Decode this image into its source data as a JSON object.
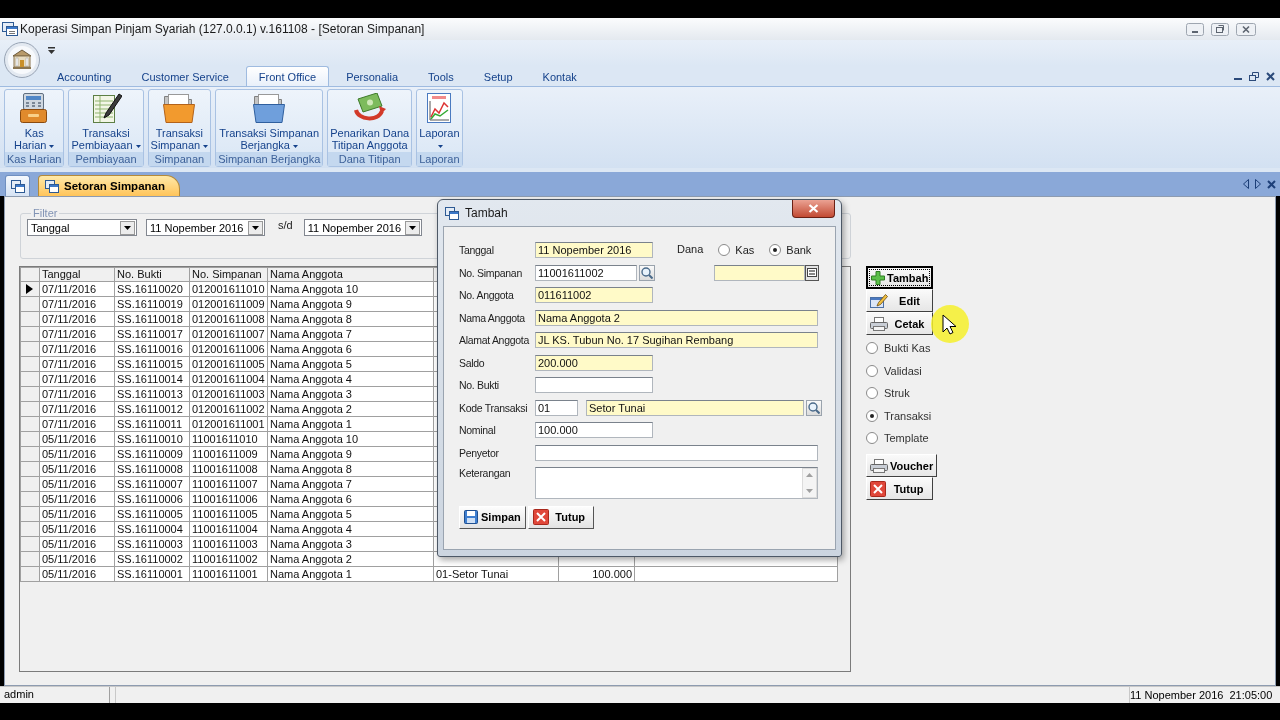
{
  "window": {
    "title": "Koperasi Simpan Pinjam Syariah (127.0.0.1) v.161108 - [Setoran Simpanan]"
  },
  "ribbon": {
    "tabs": [
      {
        "label": "Accounting",
        "selected": false
      },
      {
        "label": "Customer Service",
        "selected": false
      },
      {
        "label": "Front Office",
        "selected": true
      },
      {
        "label": "Personalia",
        "selected": false
      },
      {
        "label": "Tools",
        "selected": false
      },
      {
        "label": "Setup",
        "selected": false
      },
      {
        "label": "Kontak",
        "selected": false
      }
    ],
    "groups": [
      {
        "caption": "Kas Harian",
        "button": {
          "lines": [
            "Kas",
            "Harian"
          ],
          "dropdown": true
        }
      },
      {
        "caption": "Pembiayaan",
        "button": {
          "lines": [
            "Transaksi",
            "Pembiayaan"
          ],
          "dropdown": true
        }
      },
      {
        "caption": "Simpanan",
        "button": {
          "lines": [
            "Transaksi",
            "Simpanan"
          ],
          "dropdown": true
        }
      },
      {
        "caption": "Simpanan Berjangka",
        "button": {
          "lines": [
            "Transaksi Simpanan",
            "Berjangka"
          ],
          "dropdown": true
        }
      },
      {
        "caption": "Dana Titipan",
        "button": {
          "lines": [
            "Penarikan Dana",
            "Titipan Anggota"
          ],
          "dropdown": false
        }
      },
      {
        "caption": "Laporan",
        "button": {
          "lines": [
            "Laporan"
          ],
          "dropdown": true
        }
      }
    ]
  },
  "documents": {
    "tabs": [
      {
        "label": "Setoran Simpanan",
        "selected": true
      }
    ]
  },
  "filter": {
    "legend": "Filter",
    "field": "Tanggal",
    "from": "11 Nopember 2016",
    "separator": "s/d",
    "to": "11 Nopember 2016"
  },
  "table": {
    "columns": [
      "Tanggal",
      "No. Bukti",
      "No. Simpanan",
      "Nama Anggota"
    ],
    "rows": [
      {
        "selected": true,
        "cells": [
          "07/11/2016",
          "SS.16110020",
          "012001611010",
          "Nama Anggota 10"
        ]
      },
      {
        "selected": false,
        "cells": [
          "07/11/2016",
          "SS.16110019",
          "012001611009",
          "Nama Anggota 9"
        ]
      },
      {
        "selected": false,
        "cells": [
          "07/11/2016",
          "SS.16110018",
          "012001611008",
          "Nama Anggota 8"
        ]
      },
      {
        "selected": false,
        "cells": [
          "07/11/2016",
          "SS.16110017",
          "012001611007",
          "Nama Anggota 7"
        ]
      },
      {
        "selected": false,
        "cells": [
          "07/11/2016",
          "SS.16110016",
          "012001611006",
          "Nama Anggota 6"
        ]
      },
      {
        "selected": false,
        "cells": [
          "07/11/2016",
          "SS.16110015",
          "012001611005",
          "Nama Anggota 5"
        ]
      },
      {
        "selected": false,
        "cells": [
          "07/11/2016",
          "SS.16110014",
          "012001611004",
          "Nama Anggota 4"
        ]
      },
      {
        "selected": false,
        "cells": [
          "07/11/2016",
          "SS.16110013",
          "012001611003",
          "Nama Anggota 3"
        ]
      },
      {
        "selected": false,
        "cells": [
          "07/11/2016",
          "SS.16110012",
          "012001611002",
          "Nama Anggota 2"
        ]
      },
      {
        "selected": false,
        "cells": [
          "07/11/2016",
          "SS.16110011",
          "012001611001",
          "Nama Anggota 1"
        ]
      },
      {
        "selected": false,
        "cells": [
          "05/11/2016",
          "SS.16110010",
          "11001611010",
          "Nama Anggota 10"
        ]
      },
      {
        "selected": false,
        "cells": [
          "05/11/2016",
          "SS.16110009",
          "11001611009",
          "Nama Anggota 9"
        ]
      },
      {
        "selected": false,
        "cells": [
          "05/11/2016",
          "SS.16110008",
          "11001611008",
          "Nama Anggota 8"
        ]
      },
      {
        "selected": false,
        "cells": [
          "05/11/2016",
          "SS.16110007",
          "11001611007",
          "Nama Anggota 7"
        ]
      },
      {
        "selected": false,
        "cells": [
          "05/11/2016",
          "SS.16110006",
          "11001611006",
          "Nama Anggota 6"
        ]
      },
      {
        "selected": false,
        "cells": [
          "05/11/2016",
          "SS.16110005",
          "11001611005",
          "Nama Anggota 5"
        ]
      },
      {
        "selected": false,
        "cells": [
          "05/11/2016",
          "SS.16110004",
          "11001611004",
          "Nama Anggota 4"
        ]
      },
      {
        "selected": false,
        "cells": [
          "05/11/2016",
          "SS.16110003",
          "11001611003",
          "Nama Anggota 3"
        ]
      },
      {
        "selected": false,
        "cells": [
          "05/11/2016",
          "SS.16110002",
          "11001611002",
          "Nama Anggota 2"
        ]
      },
      {
        "selected": false,
        "cells": [
          "05/11/2016",
          "SS.16110001",
          "11001611001",
          "Nama Anggota 1",
          "01-Setor Tunai",
          "100.000"
        ]
      }
    ]
  },
  "actions": [
    {
      "label": "Tambah",
      "focused": true
    },
    {
      "label": "Edit",
      "focused": false
    },
    {
      "label": "Cetak",
      "focused": false
    }
  ],
  "print_options": [
    {
      "label": "Bukti Kas",
      "selected": false
    },
    {
      "label": "Validasi",
      "selected": false
    },
    {
      "label": "Struk",
      "selected": false
    },
    {
      "label": "Transaksi",
      "selected": true
    },
    {
      "label": "Template",
      "selected": false
    }
  ],
  "bottom_actions": [
    {
      "label": "Voucher"
    },
    {
      "label": "Tutup"
    }
  ],
  "dialog": {
    "title": "Tambah",
    "fields": [
      {
        "label": "Tanggal",
        "kind": "short",
        "value": "11 Nopember 2016",
        "readonly": true
      },
      {
        "label": "No. Simpanan",
        "kind": "lookup",
        "value": "11001611002",
        "readonly": false
      },
      {
        "label": "No. Anggota",
        "kind": "short",
        "value": "011611002",
        "readonly": true
      },
      {
        "label": "Nama Anggota",
        "kind": "long",
        "value": "Nama Anggota 2",
        "readonly": true
      },
      {
        "label": "Alamat Anggota",
        "kind": "long",
        "value": "JL KS. Tubun No. 17 Sugihan Rembang",
        "readonly": true
      },
      {
        "label": "Saldo",
        "kind": "short",
        "value": "200.000",
        "readonly": true
      },
      {
        "label": "No. Bukti",
        "kind": "short",
        "readonly": false
      },
      {
        "label": "Kode Transaksi",
        "kind": "code",
        "value": "01",
        "readonly": false,
        "description": {
          "value": "Setor Tunai",
          "readonly": true
        }
      },
      {
        "label": "Nominal",
        "kind": "short",
        "value": "100.000",
        "readonly": false
      },
      {
        "label": "Penyetor",
        "kind": "long",
        "readonly": false
      },
      {
        "label": "Keterangan",
        "kind": "memo",
        "readonly": false
      }
    ],
    "dana": {
      "label": "Dana",
      "options": [
        {
          "label": "Kas",
          "selected": false
        },
        {
          "label": "Bank",
          "selected": true
        }
      ]
    },
    "bank_account": {
      "readonly": true
    },
    "buttons": [
      {
        "label": "Simpan"
      },
      {
        "label": "Tutup"
      }
    ]
  },
  "status_bar": {
    "user": "admin",
    "datetime": "11 Nopember 2016  21:05:00"
  }
}
